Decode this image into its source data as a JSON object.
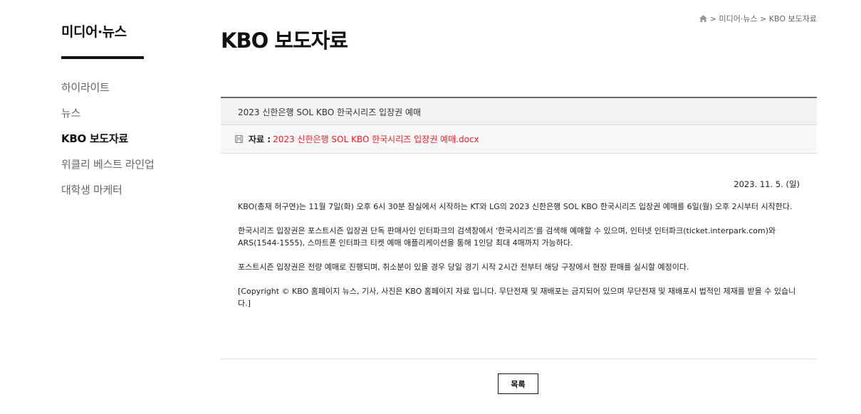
{
  "sidebar": {
    "title": "미디어·뉴스",
    "items": [
      {
        "label": "하이라이트"
      },
      {
        "label": "뉴스"
      },
      {
        "label": "KBO 보도자료"
      },
      {
        "label": "위클리 베스트 라인업"
      },
      {
        "label": "대학생 마케터"
      }
    ]
  },
  "breadcrumb": {
    "sep1": " > ",
    "item1": "미디어·뉴스",
    "sep2": " > ",
    "item2": "KBO 보도자료"
  },
  "page": {
    "title": "KBO 보도자료"
  },
  "article": {
    "title": "2023 신한은행 SOL KBO 한국시리즈 입장권 예매",
    "attachment_label": "자료 :",
    "attachment_file": "2023 신한은행 SOL KBO 한국시리즈 입장권 예매.docx",
    "date": "2023. 11. 5. (일)",
    "paragraphs": [
      "KBO(총재 허구연)는 11월 7일(화) 오후 6시 30분 잠실에서 시작하는 KT와 LG의 2023 신한은행 SOL KBO 한국시리즈 입장권 예매를 6일(월) 오후 2시부터 시작한다.",
      "한국시리즈 입장권은 포스트시즌 입장권 단독 판매사인 인터파크의 검색창에서 '한국시리즈'를 검색해 예매할 수 있으며, 인터넷 인터파크(ticket.interpark.com)와 ARS(1544-1555), 스마트폰 인터파크 티켓 예매 애플리케이션을 통해 1인당 최대 4매까지 가능하다.",
      "포스트시즌 입장권은 전량 예매로 진행되며, 취소분이 있을 경우 당일 경기 시작 2시간 전부터 해당 구장에서 현장 판매를 실시할 예정이다.",
      "[Copyright © KBO 홈페이지 뉴스, 기사, 사진은 KBO 홈페이지 자료 입니다. 무단전재 및 재배포는 금지되어 있으며 무단전재 및 재배포시 법적인 제재를 받을 수 있습니다.]"
    ]
  },
  "buttons": {
    "list": "목록"
  },
  "colors": {
    "accent_red": "#e8222a"
  }
}
